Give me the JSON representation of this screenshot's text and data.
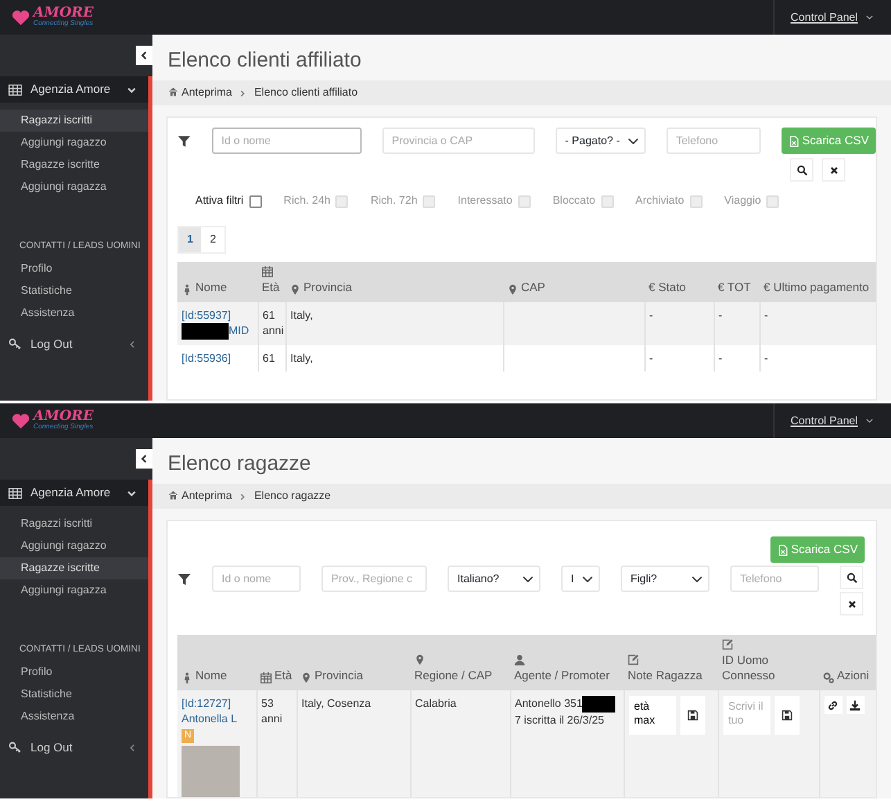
{
  "panels": [
    {
      "topbar": {
        "logo": "AMORE",
        "tagline": "Connecting Singles",
        "menu": "Control Panel"
      },
      "sidebar": {
        "group": {
          "label": "Agenzia Amore",
          "expanded": true,
          "items": [
            {
              "label": "Ragazzi iscritti",
              "selected": true
            },
            {
              "label": "Aggiungi ragazzo",
              "selected": false
            },
            {
              "label": "Ragazze iscritte",
              "selected": false
            },
            {
              "label": "Aggiungi ragazza",
              "selected": false
            }
          ]
        },
        "section": "CONTATTI / LEADS UOMINI",
        "links": [
          "Profilo",
          "Statistiche",
          "Assistenza"
        ],
        "logout": "Log Out"
      },
      "page_title": "Elenco clienti affiliato",
      "breadcrumb": [
        "Anteprima",
        "Elenco clienti affiliato"
      ],
      "filters": [
        {
          "kind": "input",
          "placeholder": "Id o nome",
          "focused": true
        },
        {
          "kind": "input",
          "placeholder": "Provincia o CAP",
          "focused": false
        },
        {
          "kind": "select",
          "value": "- Pagato? -"
        },
        {
          "kind": "input",
          "placeholder": "Telefono",
          "focused": false
        }
      ],
      "csv_button": "Scarica CSV",
      "checkbox_filters": [
        {
          "label": "Attiva filtri",
          "checked": false,
          "disabled": false
        },
        {
          "label": "Rich. 24h",
          "checked": false,
          "disabled": true
        },
        {
          "label": "Rich. 72h",
          "checked": false,
          "disabled": true
        },
        {
          "label": "Interessato",
          "checked": false,
          "disabled": true
        },
        {
          "label": "Bloccato",
          "checked": false,
          "disabled": true
        },
        {
          "label": "Archiviato",
          "checked": false,
          "disabled": true
        },
        {
          "label": "Viaggio",
          "checked": false,
          "disabled": true
        }
      ],
      "pagination": [
        {
          "label": "1",
          "selected": true
        },
        {
          "label": "2",
          "selected": false
        }
      ],
      "table": {
        "columns": [
          {
            "label": "Nome",
            "kind": "person"
          },
          {
            "label": "Età",
            "kind": "date"
          },
          {
            "label": "Provincia",
            "kind": "place"
          },
          {
            "label": "CAP",
            "kind": "place"
          },
          {
            "label": "€ Stato",
            "kind": "plain"
          },
          {
            "label": "€ TOT",
            "kind": "plain"
          },
          {
            "label": "€ Ultimo pagamento",
            "kind": "plain"
          }
        ],
        "rows": [
          {
            "cells": [
              {
                "kind": "name",
                "id": "[Id:55937]",
                "redacted": true,
                "name": "MID"
              },
              {
                "kind": "text",
                "text": "61 anni"
              },
              {
                "kind": "text",
                "text": "Italy,"
              },
              {
                "kind": "blank"
              },
              {
                "kind": "text",
                "text": "-"
              },
              {
                "kind": "text",
                "text": "-"
              },
              {
                "kind": "text",
                "text": "-"
              }
            ]
          },
          {
            "cells": [
              {
                "kind": "name",
                "id": "[Id:55936]"
              },
              {
                "kind": "text",
                "text": "61"
              },
              {
                "kind": "text",
                "text": "Italy,"
              },
              {
                "kind": "blank"
              },
              {
                "kind": "text",
                "text": "-"
              },
              {
                "kind": "text",
                "text": "-"
              },
              {
                "kind": "text",
                "text": "-"
              }
            ]
          }
        ]
      }
    },
    {
      "topbar": {
        "logo": "AMORE",
        "tagline": "Connecting Singles",
        "menu": "Control Panel"
      },
      "sidebar": {
        "group": {
          "label": "Agenzia Amore",
          "expanded": true,
          "items": [
            {
              "label": "Ragazzi iscritti",
              "selected": false
            },
            {
              "label": "Aggiungi ragazzo",
              "selected": false
            },
            {
              "label": "Ragazze iscritte",
              "selected": true
            },
            {
              "label": "Aggiungi ragazza",
              "selected": false
            }
          ]
        },
        "section": "CONTATTI / LEADS UOMINI",
        "links": [
          "Profilo",
          "Statistiche",
          "Assistenza"
        ],
        "logout": "Log Out"
      },
      "page_title": "Elenco ragazze",
      "breadcrumb": [
        "Anteprima",
        "Elenco ragazze"
      ],
      "filters": [
        {
          "kind": "input",
          "placeholder": "Id o nome",
          "focused": false
        },
        {
          "kind": "input",
          "placeholder": "Prov., Regione c",
          "focused": false
        },
        {
          "kind": "select",
          "value": "Italiano?"
        },
        {
          "kind": "select",
          "value": "I"
        },
        {
          "kind": "select",
          "value": "Figli?"
        },
        {
          "kind": "input",
          "placeholder": "Telefono",
          "focused": false
        }
      ],
      "csv_button": "Scarica CSV",
      "table": {
        "columns": [
          {
            "label": "Nome",
            "kind": "person"
          },
          {
            "label": "Età",
            "kind": "date"
          },
          {
            "label": "Provincia",
            "kind": "place"
          },
          {
            "label": "Regione / CAP",
            "kind": "place"
          },
          {
            "label": "Agente / Promoter",
            "kind": "agent"
          },
          {
            "label": "Note Ragazza",
            "kind": "note"
          },
          {
            "label": "ID Uomo Connesso",
            "kind": "note"
          },
          {
            "label": "Azioni",
            "kind": "actions"
          }
        ],
        "rows": [
          {
            "cells": [
              {
                "kind": "name",
                "id": "[Id:12727]",
                "name": "Antonella L",
                "badge": "N",
                "photo": true
              },
              {
                "kind": "text",
                "text": "53 anni"
              },
              {
                "kind": "text",
                "text": "Italy, Cosenza"
              },
              {
                "kind": "text",
                "text": "Calabria"
              },
              {
                "kind": "redacted_text",
                "before": "Antonello 351",
                "after": "7 iscritta il 26/3/25"
              },
              {
                "kind": "note",
                "value": "età max"
              },
              {
                "kind": "note",
                "placeholder": "Scrivi il tuo"
              },
              {
                "kind": "actions"
              }
            ]
          }
        ]
      }
    }
  ]
}
